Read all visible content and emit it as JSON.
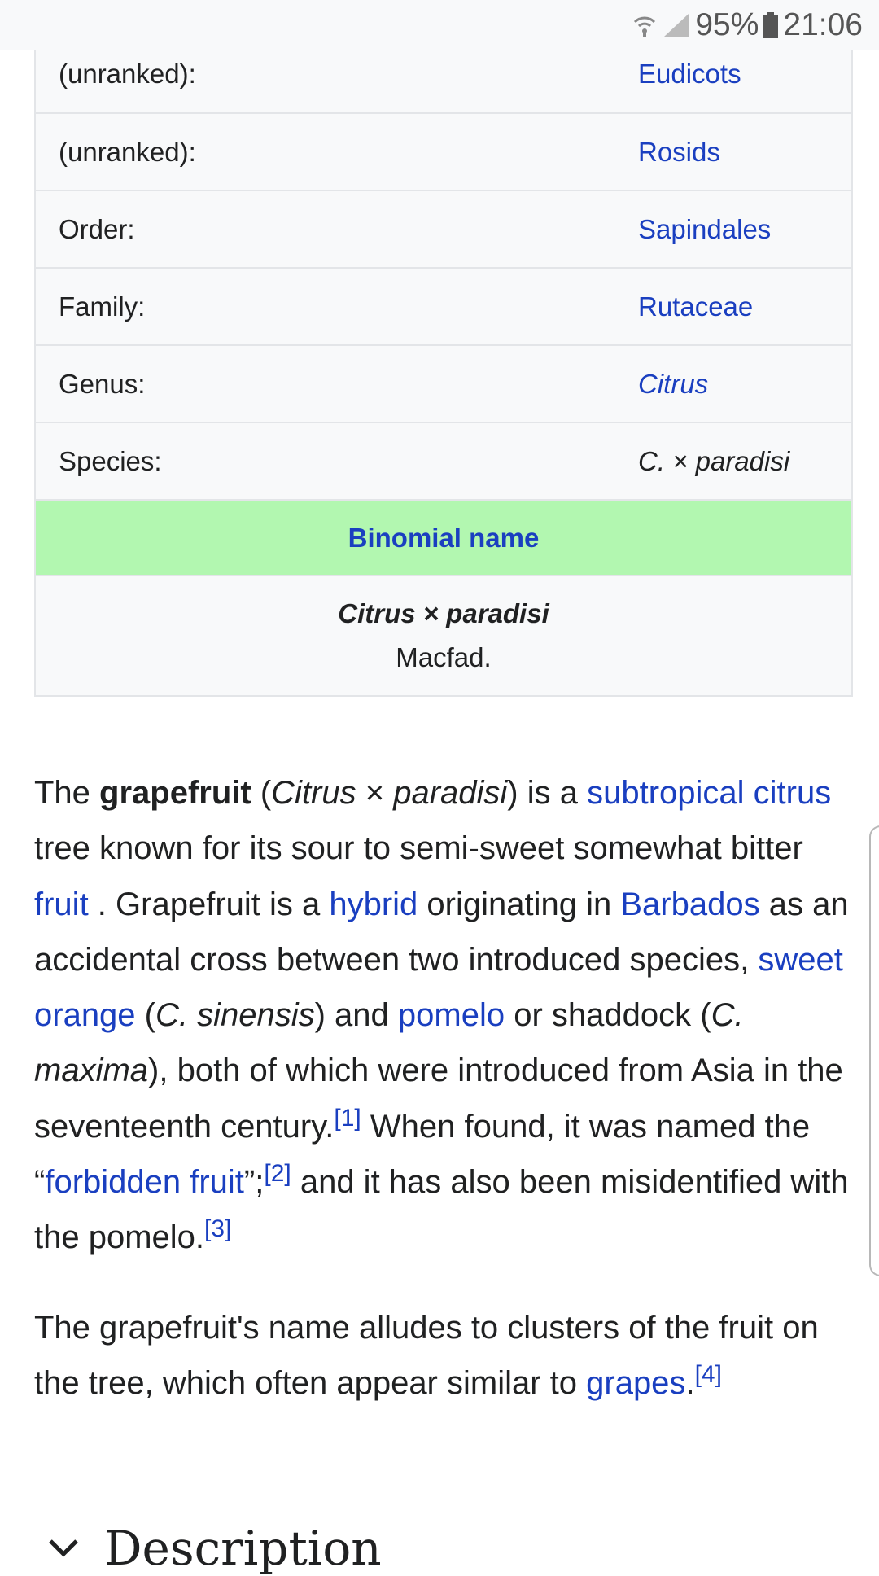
{
  "status_bar": {
    "battery": "95%",
    "time": "21:06"
  },
  "infobox": {
    "rows": [
      {
        "label": "(unranked):",
        "value": "Eudicots"
      },
      {
        "label": "(unranked):",
        "value": "Rosids"
      },
      {
        "label": "Order:",
        "value": "Sapindales"
      },
      {
        "label": "Family:",
        "value": "Rutaceae"
      },
      {
        "label": "Genus:",
        "value": "Citrus"
      },
      {
        "label": "Species:",
        "value": "C. × paradisi"
      }
    ],
    "binomial_header": "Binomial name",
    "binomial_name": "Citrus × paradisi",
    "binomial_authority": "Macfad."
  },
  "article": {
    "p1": {
      "t1": "The ",
      "grapefruit": "grapefruit",
      "t2": " (",
      "sci1": "Citrus",
      "t3": " × ",
      "sci2": "paradisi",
      "t4": ") is a ",
      "link_subtropical": "subtropical",
      "t5": " ",
      "link_citrus": "citrus",
      "t6": " tree known for its sour to semi-sweet somewhat bitter ",
      "link_fruit": "fruit",
      "t7": " . Grapefruit is a ",
      "link_hybrid": "hybrid",
      "t8": " originating in ",
      "link_barbados": "Barbados",
      "t9": " as an accidental cross between two introduced species, ",
      "link_sweet_orange": "sweet orange",
      "t10": " (",
      "sci3": "C. sinensis",
      "t11": ") and ",
      "link_pomelo": "pomelo",
      "t12": " or shaddock (",
      "sci4": "C. maxima",
      "t13": "), both of which were introduced from Asia in the seventeenth century.",
      "ref1": "[1]",
      "t14": " When found, it was named the “",
      "link_forbidden": "forbidden fruit",
      "t15": "”;",
      "ref2": "[2]",
      "t16": " and it has also been misidentified with the pomelo.",
      "ref3": "[3]"
    },
    "p2": {
      "t1": "The grapefruit's name alludes to clusters of the fruit on the tree, which often appear similar to ",
      "link_grapes": "grapes",
      "t2": ".",
      "ref4": "[4]"
    }
  },
  "section": {
    "title": "Description"
  }
}
